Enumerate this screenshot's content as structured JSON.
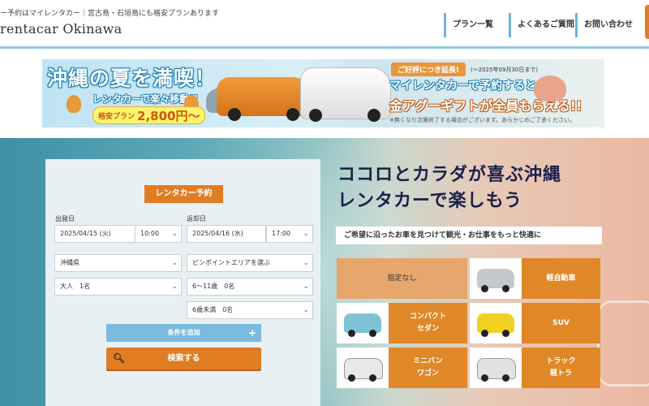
{
  "header": {
    "tagline": "ー予約はマイレンタカー｜宮古島・石垣島にも格安プランあります",
    "brand": "rentacar Okinawa",
    "nav": [
      {
        "label": "プラン一覧"
      },
      {
        "label": "よくあるご質問"
      },
      {
        "label": "お問い合わせ"
      }
    ]
  },
  "banner": {
    "title": "沖縄の夏を満喫！",
    "subtitle": "レンタカーで楽々移動!!",
    "plan_name": "格安プラン",
    "plan_price": "2,800円〜",
    "ribbon": "ご好評につき延長!",
    "period": "(〜2025年09月30日まで)",
    "promo_line1": "マイレンタカーで予約すると",
    "promo_line2": "金アグーギフトが全員もらえる!!",
    "note": "※無くなり次第終了する場合がございます。あらかじめご了承ください。"
  },
  "search": {
    "tab_label": "レンタカー予約",
    "departure_label": "出発日",
    "return_label": "返却日",
    "departure_date": "2025/04/15 (火)",
    "departure_time": "10:00",
    "return_date": "2025/04/16 (水)",
    "return_time": "17:00",
    "prefecture": "沖縄県",
    "area": "ピンポイントエリアを選ぶ",
    "adults": "大人　1名",
    "children_6_11": "6〜11歳　0名",
    "children_under6": "6歳未満　0名",
    "add_conditions": "条件を追加",
    "search_button": "検索する"
  },
  "hero": {
    "title_line1": "ココロとカラダが喜ぶ沖縄",
    "title_line2": "レンタカーで楽しもう",
    "subtitle": "ご希望に沿ったお車を見つけて観光・お仕事をもっと快適に"
  },
  "car_types": [
    {
      "label": "指定なし"
    },
    {
      "label": "軽自動車",
      "car_color": "#c5c9cc"
    },
    {
      "label": "コンパクト\nセダン",
      "car_color": "#7fc2d6"
    },
    {
      "label": "SUV",
      "car_color": "#f0d21e"
    },
    {
      "label": "ミニバン\nワゴン",
      "car_color": "#e8e8e8"
    },
    {
      "label": "トラック\n軽トラ",
      "car_color": "#dfe3e6"
    }
  ],
  "colors": {
    "accent": "#e07d22",
    "nav_rule": "#6fb4d6",
    "add_button": "#7bbbde",
    "heading": "#1b1f4a"
  }
}
